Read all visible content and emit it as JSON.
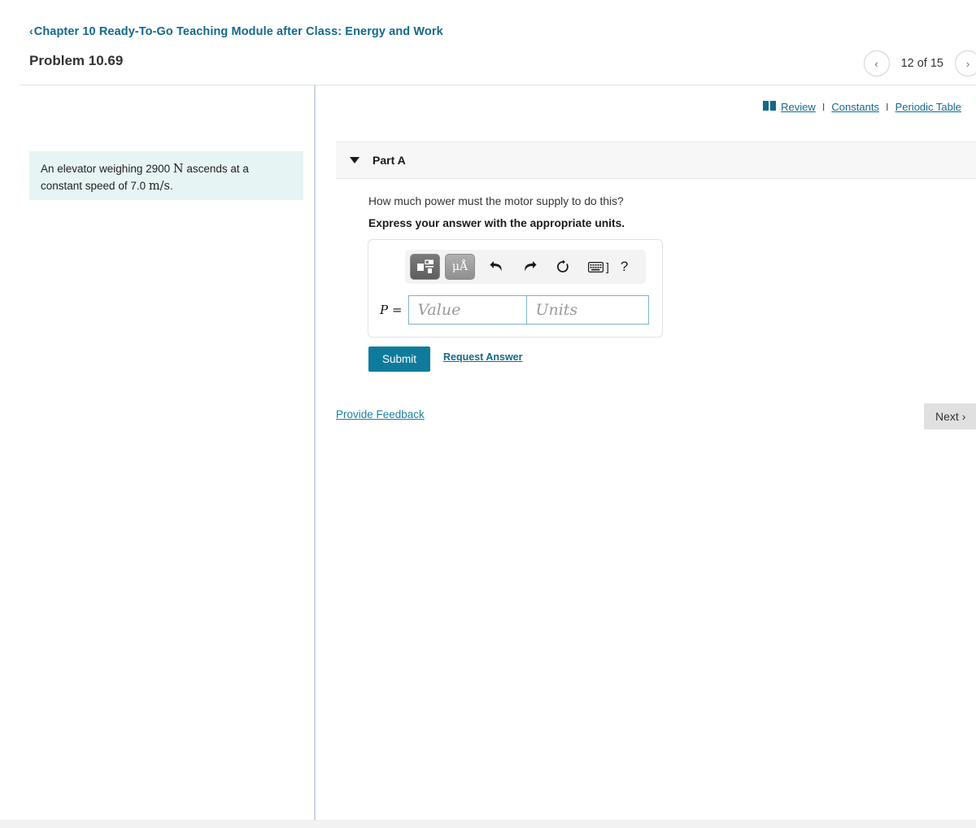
{
  "header": {
    "breadcrumb_chevron": "‹",
    "breadcrumb": "Chapter 10 Ready-To-Go Teaching Module after Class: Energy and Work",
    "problem_title": "Problem 10.69",
    "pager": {
      "prev_icon": "‹",
      "next_icon": "›",
      "count": "12 of 15"
    }
  },
  "toplinks": {
    "book_icon": "book-icon",
    "review": "Review",
    "sep1": "I",
    "constants": "Constants",
    "sep2": "I",
    "periodic_table": "Periodic Table"
  },
  "problem": {
    "text_part1": "An elevator weighing 2900",
    "unit1": "N",
    "text_part2": "ascends at a constant speed of 7.0",
    "unit2": "m/s",
    "text_part3": "."
  },
  "part": {
    "label": "Part A",
    "question": "How much power must the motor supply to do this?",
    "express": "Express your answer with the appropriate units."
  },
  "answer": {
    "toolbar": {
      "template_button": "math-template",
      "units_button": "μÅ",
      "undo": "↶",
      "redo": "↷",
      "reset": "↻",
      "keyboard": "keyboard-icon",
      "bracket": "]",
      "help": "?"
    },
    "variable_label": "P",
    "equals": "=",
    "value_placeholder": "Value",
    "units_placeholder": "Units",
    "value": "",
    "units": ""
  },
  "actions": {
    "submit": "Submit",
    "request_answer": "Request Answer",
    "provide_feedback": "Provide Feedback",
    "next": "Next",
    "next_chevron": "›"
  },
  "colors": {
    "link_teal": "#14698c",
    "submit_teal": "#0f7b9c",
    "problem_box_bg": "#e7f4f4",
    "part_header_bg": "#f7f7f7",
    "divider": "#c9d6e4"
  }
}
